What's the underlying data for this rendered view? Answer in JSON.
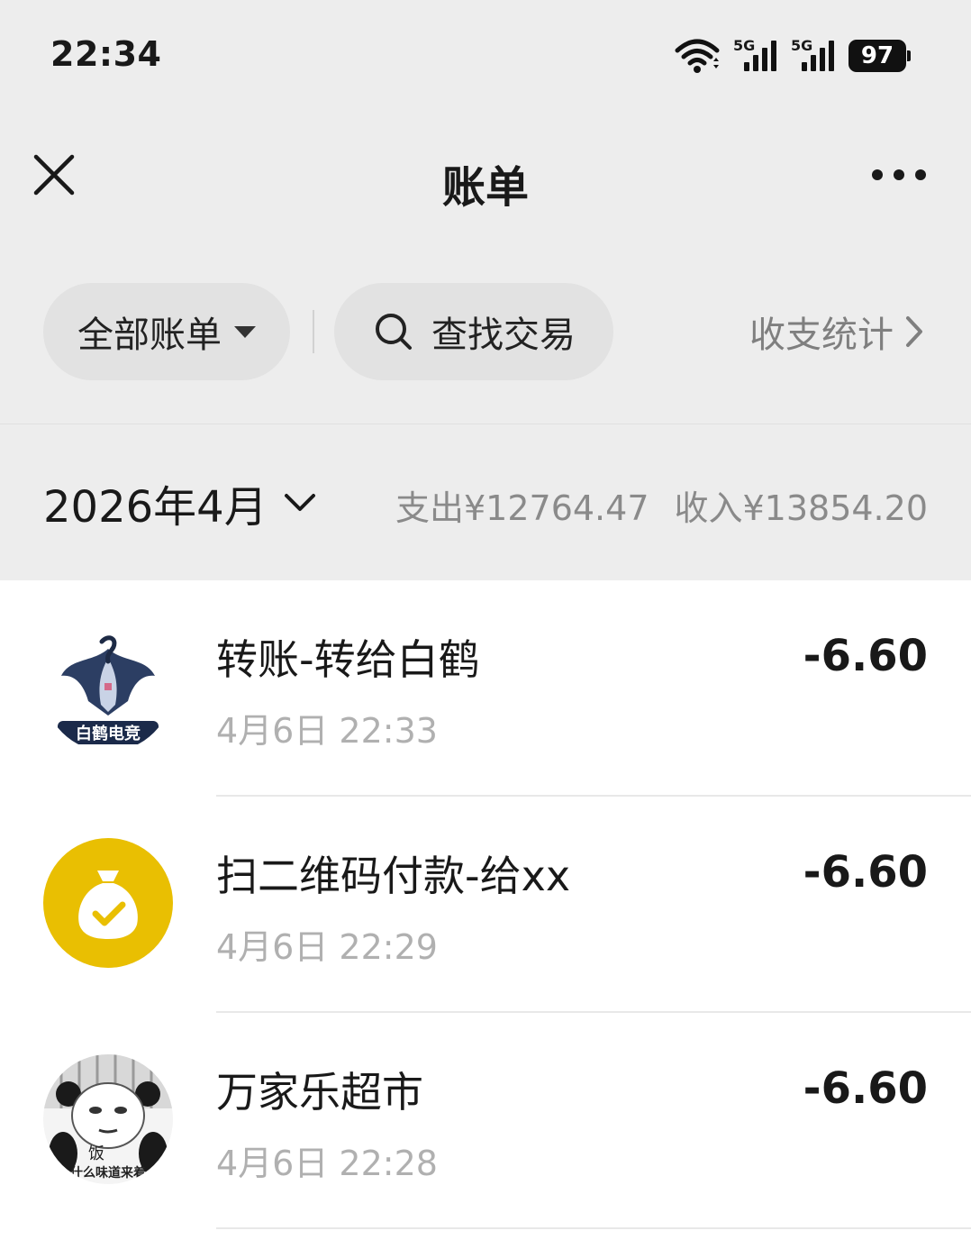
{
  "status_bar": {
    "time": "22:34",
    "network_1": "5G",
    "network_2": "5G",
    "battery": "97"
  },
  "nav": {
    "title": "账单"
  },
  "filters": {
    "all_bills_label": "全部账单",
    "search_label": "查找交易",
    "stats_label": "收支统计"
  },
  "month": {
    "label": "2026年4月",
    "expense": "支出¥12764.47",
    "income": "收入¥13854.20"
  },
  "transactions": [
    {
      "name": "转账-转给白鹤",
      "time": "4月6日 22:33",
      "amount": "-6.60",
      "avatar_text": "白鹤电竞"
    },
    {
      "name": "扫二维码付款-给xx",
      "time": "4月6日 22:29",
      "amount": "-6.60",
      "avatar_color": "#e9bf02"
    },
    {
      "name": "万家乐超市",
      "time": "4月6日 22:28",
      "amount": "-6.60",
      "avatar_text_1": "饭",
      "avatar_text_2": "什么味道来着"
    }
  ]
}
